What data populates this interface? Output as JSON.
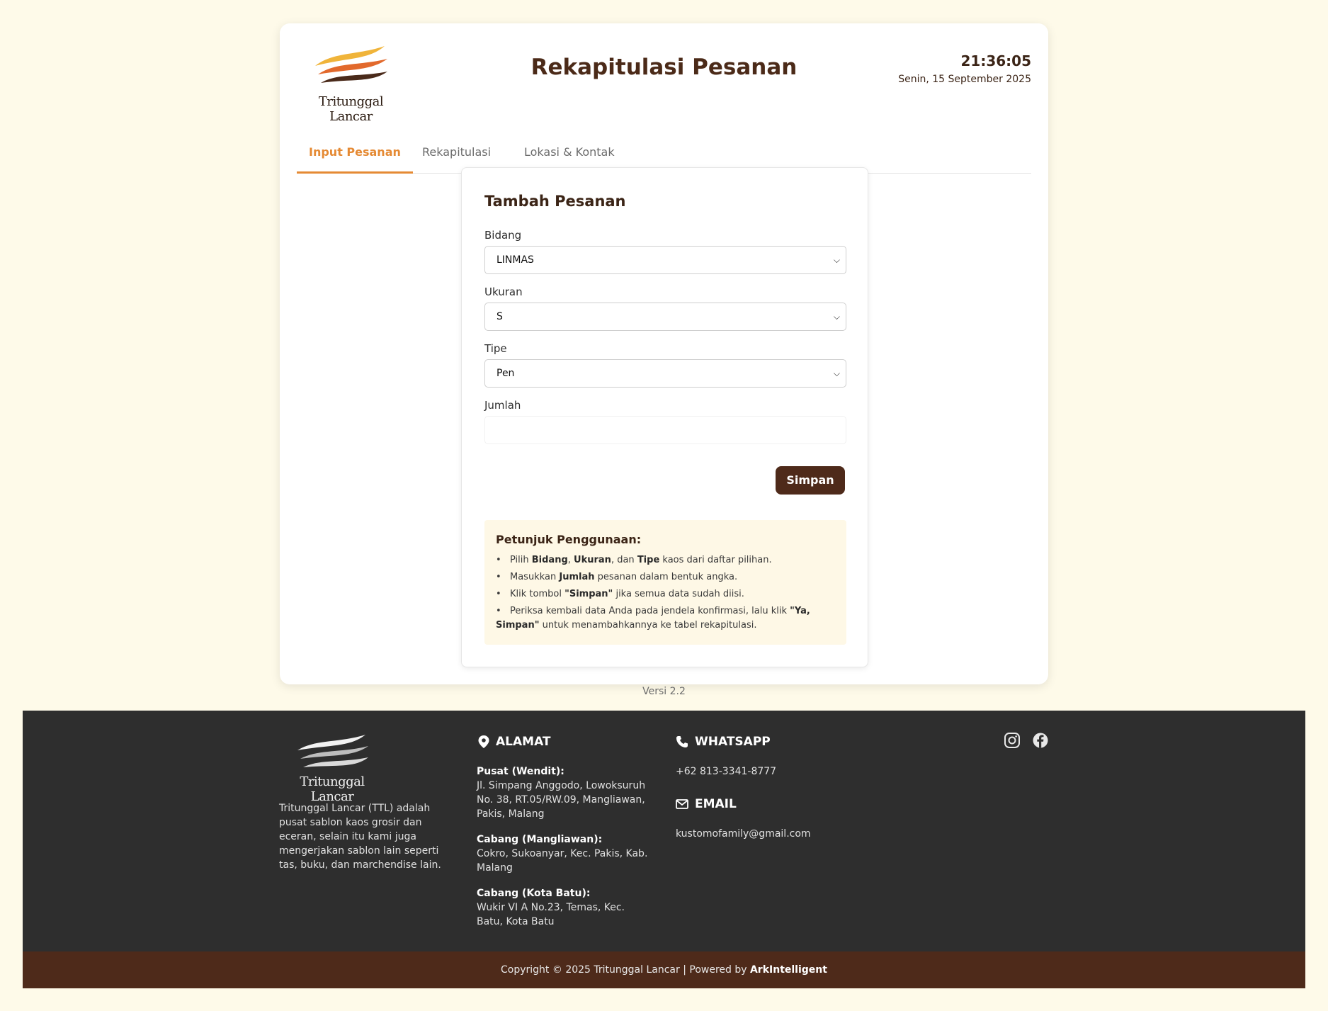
{
  "brand": {
    "name": "Tritunggal Lancar"
  },
  "header": {
    "title": "Rekapitulasi Pesanan",
    "time": "21:36:05",
    "date": "Senin, 15 September 2025"
  },
  "tabs": [
    {
      "label": "Input Pesanan",
      "active": true
    },
    {
      "label": "Rekapitulasi",
      "active": false
    },
    {
      "label": "Lokasi & Kontak",
      "active": false
    }
  ],
  "form": {
    "title": "Tambah Pesanan",
    "bidang_label": "Bidang",
    "bidang_value": "LINMAS",
    "ukuran_label": "Ukuran",
    "ukuran_value": "S",
    "tipe_label": "Tipe",
    "tipe_value": "Pen",
    "jumlah_label": "Jumlah",
    "jumlah_value": "",
    "submit_label": "Simpan"
  },
  "guide": {
    "title": "Petunjuk Penggunaan:",
    "items": [
      {
        "t1": "Pilih ",
        "b1": "Bidang",
        "t2": ", ",
        "b2": "Ukuran",
        "t3": ", dan ",
        "b3": "Tipe",
        "t4": " kaos dari daftar pilihan."
      },
      {
        "t1": "Masukkan ",
        "b1": "Jumlah",
        "t2": " pesanan dalam bentuk angka."
      },
      {
        "t1": "Klik tombol ",
        "b1": "\"Simpan\"",
        "t2": " jika semua data sudah diisi."
      },
      {
        "t1": "Periksa kembali data Anda pada jendela konfirmasi, lalu klik ",
        "b1": "\"Ya, Simpan\"",
        "t2": " untuk menambahkannya ke tabel rekapitulasi."
      }
    ]
  },
  "version": "Versi 2.2",
  "footer": {
    "about": "Tritunggal Lancar (TTL) adalah pusat sablon kaos grosir dan eceran, selain itu kami juga mengerjakan sablon lain seperti tas, buku, dan marchendise lain.",
    "address_heading": "ALAMAT",
    "addresses": [
      {
        "name": "Pusat (Wendit):",
        "detail": "Jl. Simpang Anggodo, Lowoksuruh No. 38, RT.05/RW.09, Mangliawan, Pakis, Malang"
      },
      {
        "name": "Cabang (Mangliawan):",
        "detail": "Cokro, Sukoanyar, Kec. Pakis, Kab. Malang"
      },
      {
        "name": "Cabang (Kota Batu):",
        "detail": "Wukir VI A No.23, Temas, Kec. Batu, Kota Batu"
      }
    ],
    "whatsapp_heading": "WHATSAPP",
    "whatsapp": "+62 813-3341-8777",
    "email_heading": "EMAIL",
    "email": "kustomofamily@gmail.com",
    "social": [
      "instagram-icon",
      "facebook-icon"
    ]
  },
  "copyright": {
    "text": "Copyright © 2025 Tritunggal Lancar | Powered by ",
    "powered_by": "ArkIntelligent"
  },
  "colors": {
    "background": "#fefae9",
    "accent": "#e58a34",
    "brand_brown": "#4e2a1a",
    "footer_bg": "#2e2e2e"
  }
}
